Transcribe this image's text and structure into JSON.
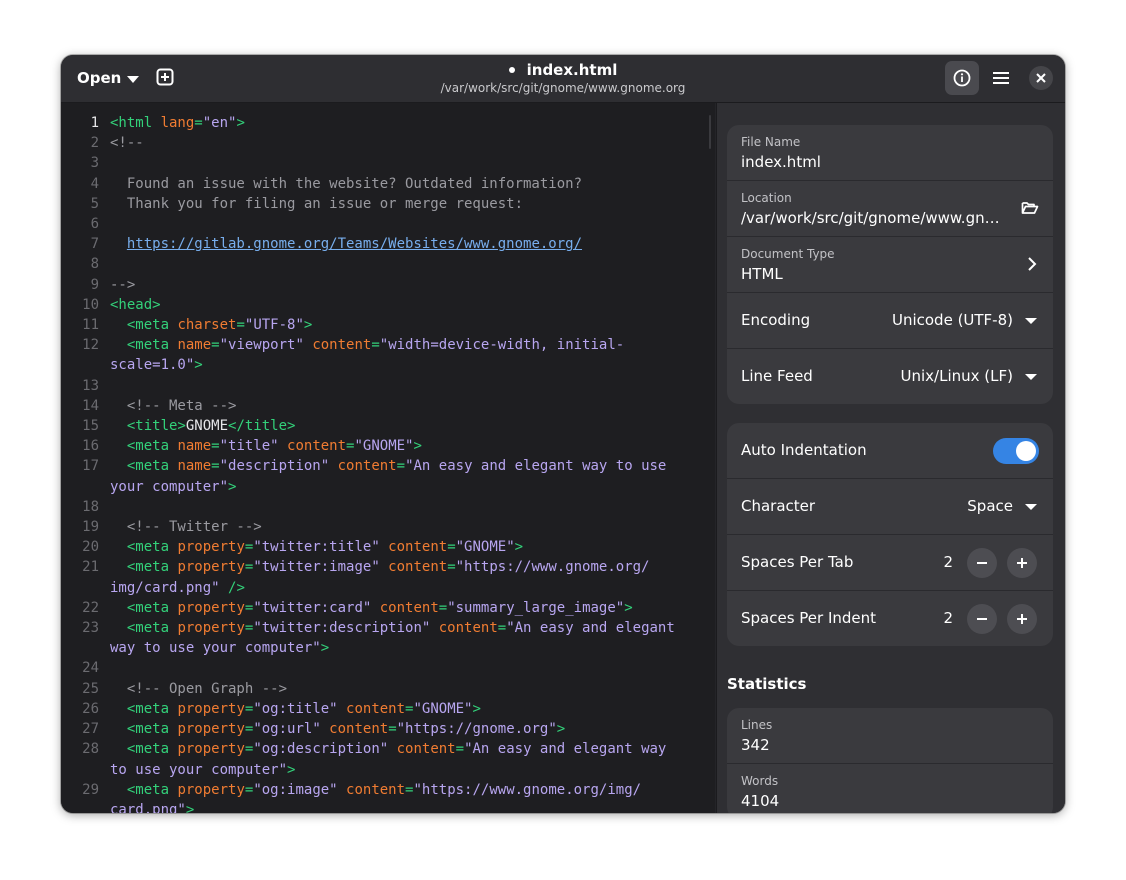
{
  "header": {
    "open_label": "Open",
    "title": "index.html",
    "subtitle": "/var/work/src/git/gnome/www.gnome.org",
    "modified_dot": "•"
  },
  "editor": {
    "lines": [
      {
        "n": "1",
        "segs": [
          [
            "tag",
            "<html "
          ],
          [
            "attr",
            "lang"
          ],
          [
            "tag",
            "="
          ],
          [
            "val",
            "\"en\""
          ],
          [
            "tag",
            ">"
          ]
        ]
      },
      {
        "n": "2",
        "segs": [
          [
            "com",
            "<!--"
          ]
        ]
      },
      {
        "n": "3",
        "segs": []
      },
      {
        "n": "4",
        "segs": [
          [
            "com",
            "  Found an issue with the website? Outdated information?"
          ]
        ]
      },
      {
        "n": "5",
        "segs": [
          [
            "com",
            "  Thank you for filing an issue or merge request:"
          ]
        ]
      },
      {
        "n": "6",
        "segs": []
      },
      {
        "n": "7",
        "segs": [
          [
            "com",
            "  "
          ],
          [
            "link",
            "https://gitlab.gnome.org/Teams/Websites/www.gnome.org/"
          ]
        ]
      },
      {
        "n": "8",
        "segs": []
      },
      {
        "n": "9",
        "segs": [
          [
            "com",
            "-->"
          ]
        ]
      },
      {
        "n": "10",
        "segs": [
          [
            "tag",
            "<head>"
          ]
        ]
      },
      {
        "n": "11",
        "segs": [
          [
            "tag",
            "  <meta "
          ],
          [
            "attr",
            "charset"
          ],
          [
            "tag",
            "="
          ],
          [
            "val",
            "\"UTF-8\""
          ],
          [
            "tag",
            ">"
          ]
        ]
      },
      {
        "n": "12",
        "segs": [
          [
            "tag",
            "  <meta "
          ],
          [
            "attr",
            "name"
          ],
          [
            "tag",
            "="
          ],
          [
            "val",
            "\"viewport\" "
          ],
          [
            "attr",
            "content"
          ],
          [
            "tag",
            "="
          ],
          [
            "val",
            "\"width=device-width, initial-"
          ]
        ],
        "wrap": [
          [
            "val",
            "scale=1.0\""
          ],
          [
            "tag",
            ">"
          ]
        ]
      },
      {
        "n": "13",
        "segs": []
      },
      {
        "n": "14",
        "segs": [
          [
            "com",
            "  <!-- Meta -->"
          ]
        ]
      },
      {
        "n": "15",
        "segs": [
          [
            "tag",
            "  <title>"
          ],
          [
            "txt",
            "GNOME"
          ],
          [
            "tag",
            "</title>"
          ]
        ]
      },
      {
        "n": "16",
        "segs": [
          [
            "tag",
            "  <meta "
          ],
          [
            "attr",
            "name"
          ],
          [
            "tag",
            "="
          ],
          [
            "val",
            "\"title\" "
          ],
          [
            "attr",
            "content"
          ],
          [
            "tag",
            "="
          ],
          [
            "val",
            "\"GNOME\""
          ],
          [
            "tag",
            ">"
          ]
        ]
      },
      {
        "n": "17",
        "segs": [
          [
            "tag",
            "  <meta "
          ],
          [
            "attr",
            "name"
          ],
          [
            "tag",
            "="
          ],
          [
            "val",
            "\"description\" "
          ],
          [
            "attr",
            "content"
          ],
          [
            "tag",
            "="
          ],
          [
            "val",
            "\"An easy and elegant way to use"
          ]
        ],
        "wrap": [
          [
            "val",
            "your computer\""
          ],
          [
            "tag",
            ">"
          ]
        ]
      },
      {
        "n": "18",
        "segs": []
      },
      {
        "n": "19",
        "segs": [
          [
            "com",
            "  <!-- Twitter -->"
          ]
        ]
      },
      {
        "n": "20",
        "segs": [
          [
            "tag",
            "  <meta "
          ],
          [
            "attr",
            "property"
          ],
          [
            "tag",
            "="
          ],
          [
            "val",
            "\"twitter:title\" "
          ],
          [
            "attr",
            "content"
          ],
          [
            "tag",
            "="
          ],
          [
            "val",
            "\"GNOME\""
          ],
          [
            "tag",
            ">"
          ]
        ]
      },
      {
        "n": "21",
        "segs": [
          [
            "tag",
            "  <meta "
          ],
          [
            "attr",
            "property"
          ],
          [
            "tag",
            "="
          ],
          [
            "val",
            "\"twitter:image\" "
          ],
          [
            "attr",
            "content"
          ],
          [
            "tag",
            "="
          ],
          [
            "val",
            "\"https://www.gnome.org/"
          ]
        ],
        "wrap": [
          [
            "val",
            "img/card.png\" "
          ],
          [
            "tag",
            "/>"
          ]
        ]
      },
      {
        "n": "22",
        "segs": [
          [
            "tag",
            "  <meta "
          ],
          [
            "attr",
            "property"
          ],
          [
            "tag",
            "="
          ],
          [
            "val",
            "\"twitter:card\" "
          ],
          [
            "attr",
            "content"
          ],
          [
            "tag",
            "="
          ],
          [
            "val",
            "\"summary_large_image\""
          ],
          [
            "tag",
            ">"
          ]
        ]
      },
      {
        "n": "23",
        "segs": [
          [
            "tag",
            "  <meta "
          ],
          [
            "attr",
            "property"
          ],
          [
            "tag",
            "="
          ],
          [
            "val",
            "\"twitter:description\" "
          ],
          [
            "attr",
            "content"
          ],
          [
            "tag",
            "="
          ],
          [
            "val",
            "\"An easy and elegant"
          ]
        ],
        "wrap": [
          [
            "val",
            "way to use your computer\""
          ],
          [
            "tag",
            ">"
          ]
        ]
      },
      {
        "n": "24",
        "segs": []
      },
      {
        "n": "25",
        "segs": [
          [
            "com",
            "  <!-- Open Graph -->"
          ]
        ]
      },
      {
        "n": "26",
        "segs": [
          [
            "tag",
            "  <meta "
          ],
          [
            "attr",
            "property"
          ],
          [
            "tag",
            "="
          ],
          [
            "val",
            "\"og:title\" "
          ],
          [
            "attr",
            "content"
          ],
          [
            "tag",
            "="
          ],
          [
            "val",
            "\"GNOME\""
          ],
          [
            "tag",
            ">"
          ]
        ]
      },
      {
        "n": "27",
        "segs": [
          [
            "tag",
            "  <meta "
          ],
          [
            "attr",
            "property"
          ],
          [
            "tag",
            "="
          ],
          [
            "val",
            "\"og:url\" "
          ],
          [
            "attr",
            "content"
          ],
          [
            "tag",
            "="
          ],
          [
            "val",
            "\"https://gnome.org\""
          ],
          [
            "tag",
            ">"
          ]
        ]
      },
      {
        "n": "28",
        "segs": [
          [
            "tag",
            "  <meta "
          ],
          [
            "attr",
            "property"
          ],
          [
            "tag",
            "="
          ],
          [
            "val",
            "\"og:description\" "
          ],
          [
            "attr",
            "content"
          ],
          [
            "tag",
            "="
          ],
          [
            "val",
            "\"An easy and elegant way"
          ]
        ],
        "wrap": [
          [
            "val",
            "to use your computer\""
          ],
          [
            "tag",
            ">"
          ]
        ]
      },
      {
        "n": "29",
        "segs": [
          [
            "tag",
            "  <meta "
          ],
          [
            "attr",
            "property"
          ],
          [
            "tag",
            "="
          ],
          [
            "val",
            "\"og:image\" "
          ],
          [
            "attr",
            "content"
          ],
          [
            "tag",
            "="
          ],
          [
            "val",
            "\"https://www.gnome.org/img/"
          ]
        ],
        "wrap": [
          [
            "val",
            "card.png\""
          ],
          [
            "tag",
            ">"
          ]
        ]
      }
    ]
  },
  "sidebar": {
    "file_name_label": "File Name",
    "file_name_value": "index.html",
    "location_label": "Location",
    "location_value": "/var/work/src/git/gnome/www.gnome.org",
    "doc_type_label": "Document Type",
    "doc_type_value": "HTML",
    "encoding_label": "Encoding",
    "encoding_value": "Unicode (UTF-8)",
    "line_feed_label": "Line Feed",
    "line_feed_value": "Unix/Linux (LF)",
    "auto_indent_label": "Auto Indentation",
    "auto_indent_on": true,
    "character_label": "Character",
    "character_value": "Space",
    "spaces_per_tab_label": "Spaces Per Tab",
    "spaces_per_tab_value": "2",
    "spaces_per_indent_label": "Spaces Per Indent",
    "spaces_per_indent_value": "2",
    "stats_title": "Statistics",
    "lines_label": "Lines",
    "lines_value": "342",
    "words_label": "Words",
    "words_value": "4104"
  },
  "colors": {
    "accent": "#3584e4",
    "tag": "#33d17a",
    "attr": "#f07c32",
    "value": "#b8a6f0",
    "comment": "#9a9aa0"
  }
}
